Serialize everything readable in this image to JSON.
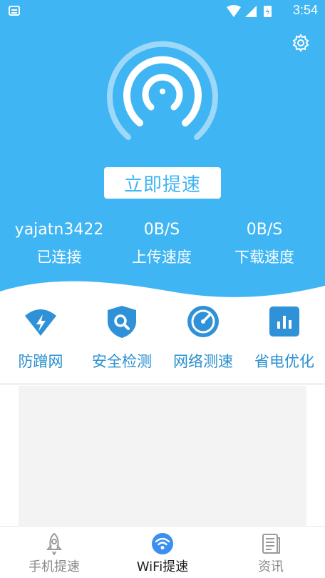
{
  "status_bar": {
    "time": "3:54"
  },
  "action": {
    "boost_label": "立即提速"
  },
  "stats": [
    {
      "value": "yajatn3422",
      "label": "已连接"
    },
    {
      "value": "0B/S",
      "label": "上传速度"
    },
    {
      "value": "0B/S",
      "label": "下载速度"
    }
  ],
  "tools": [
    {
      "label": "防蹭网",
      "icon": "wifi-shield-icon"
    },
    {
      "label": "安全检测",
      "icon": "shield-search-icon"
    },
    {
      "label": "网络测速",
      "icon": "speedometer-icon"
    },
    {
      "label": "省电优化",
      "icon": "battery-chart-icon"
    }
  ],
  "tabs": [
    {
      "label": "手机提速",
      "icon": "rocket-icon",
      "active": false
    },
    {
      "label": "WiFi提速",
      "icon": "wifi-icon",
      "active": true
    },
    {
      "label": "资讯",
      "icon": "news-icon",
      "active": false
    }
  ],
  "colors": {
    "primary": "#3fb5f4",
    "tool_text": "#2a8fd0",
    "tab_inactive": "#8a8a8a",
    "tab_active": "#222222"
  }
}
